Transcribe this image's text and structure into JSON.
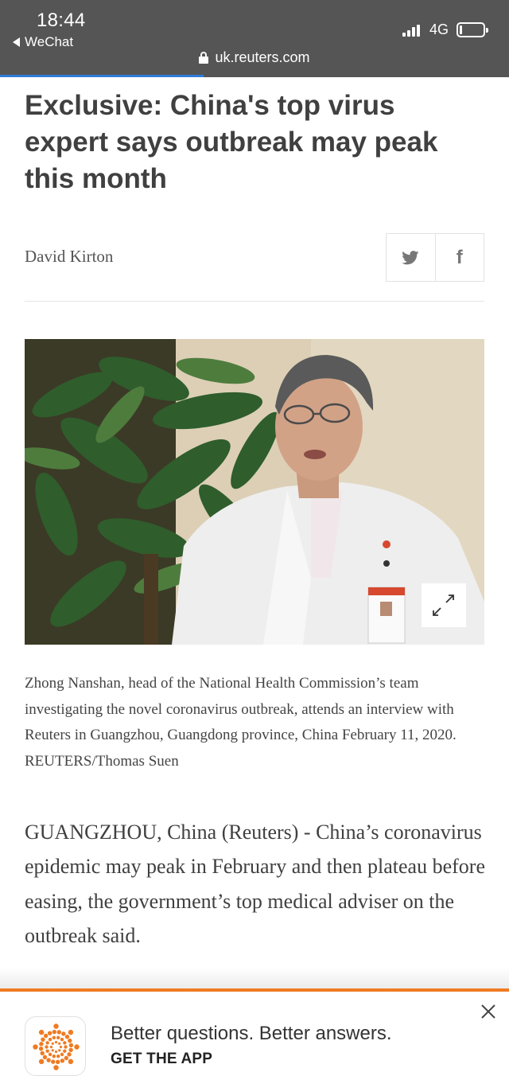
{
  "status_bar": {
    "time": "18:44",
    "back_label": "WeChat",
    "network": "4G",
    "signal_bars": 4,
    "battery_level": 0.12
  },
  "browser": {
    "url": "uk.reuters.com",
    "page_load_progress": 0.4,
    "progress_color": "#2f7ddb"
  },
  "article": {
    "headline": "Exclusive: China's top virus expert says outbreak may peak this month",
    "author": "David Kirton",
    "share": {
      "twitter_icon": "twitter-icon",
      "facebook_icon": "facebook-icon",
      "facebook_glyph": "f"
    },
    "image": {
      "expand_icon": "expand-icon"
    },
    "caption": "Zhong Nanshan, head of the National Health Commission’s team investigating the novel coronavirus outbreak, attends an interview with Reuters in Guangzhou, Guangdong province, China February 11, 2020. REUTERS/Thomas Suen",
    "lead_paragraph": "GUANGZHOU, China (Reuters) - China’s coronavirus epidemic may peak in February and then plateau before easing, the government’s top medical adviser on the outbreak said."
  },
  "app_banner": {
    "tagline": "Better questions. Better answers.",
    "cta": "GET THE APP",
    "accent_color": "#ef7b22",
    "close_icon": "close-icon",
    "logo_icon": "reuters-logo-icon"
  }
}
